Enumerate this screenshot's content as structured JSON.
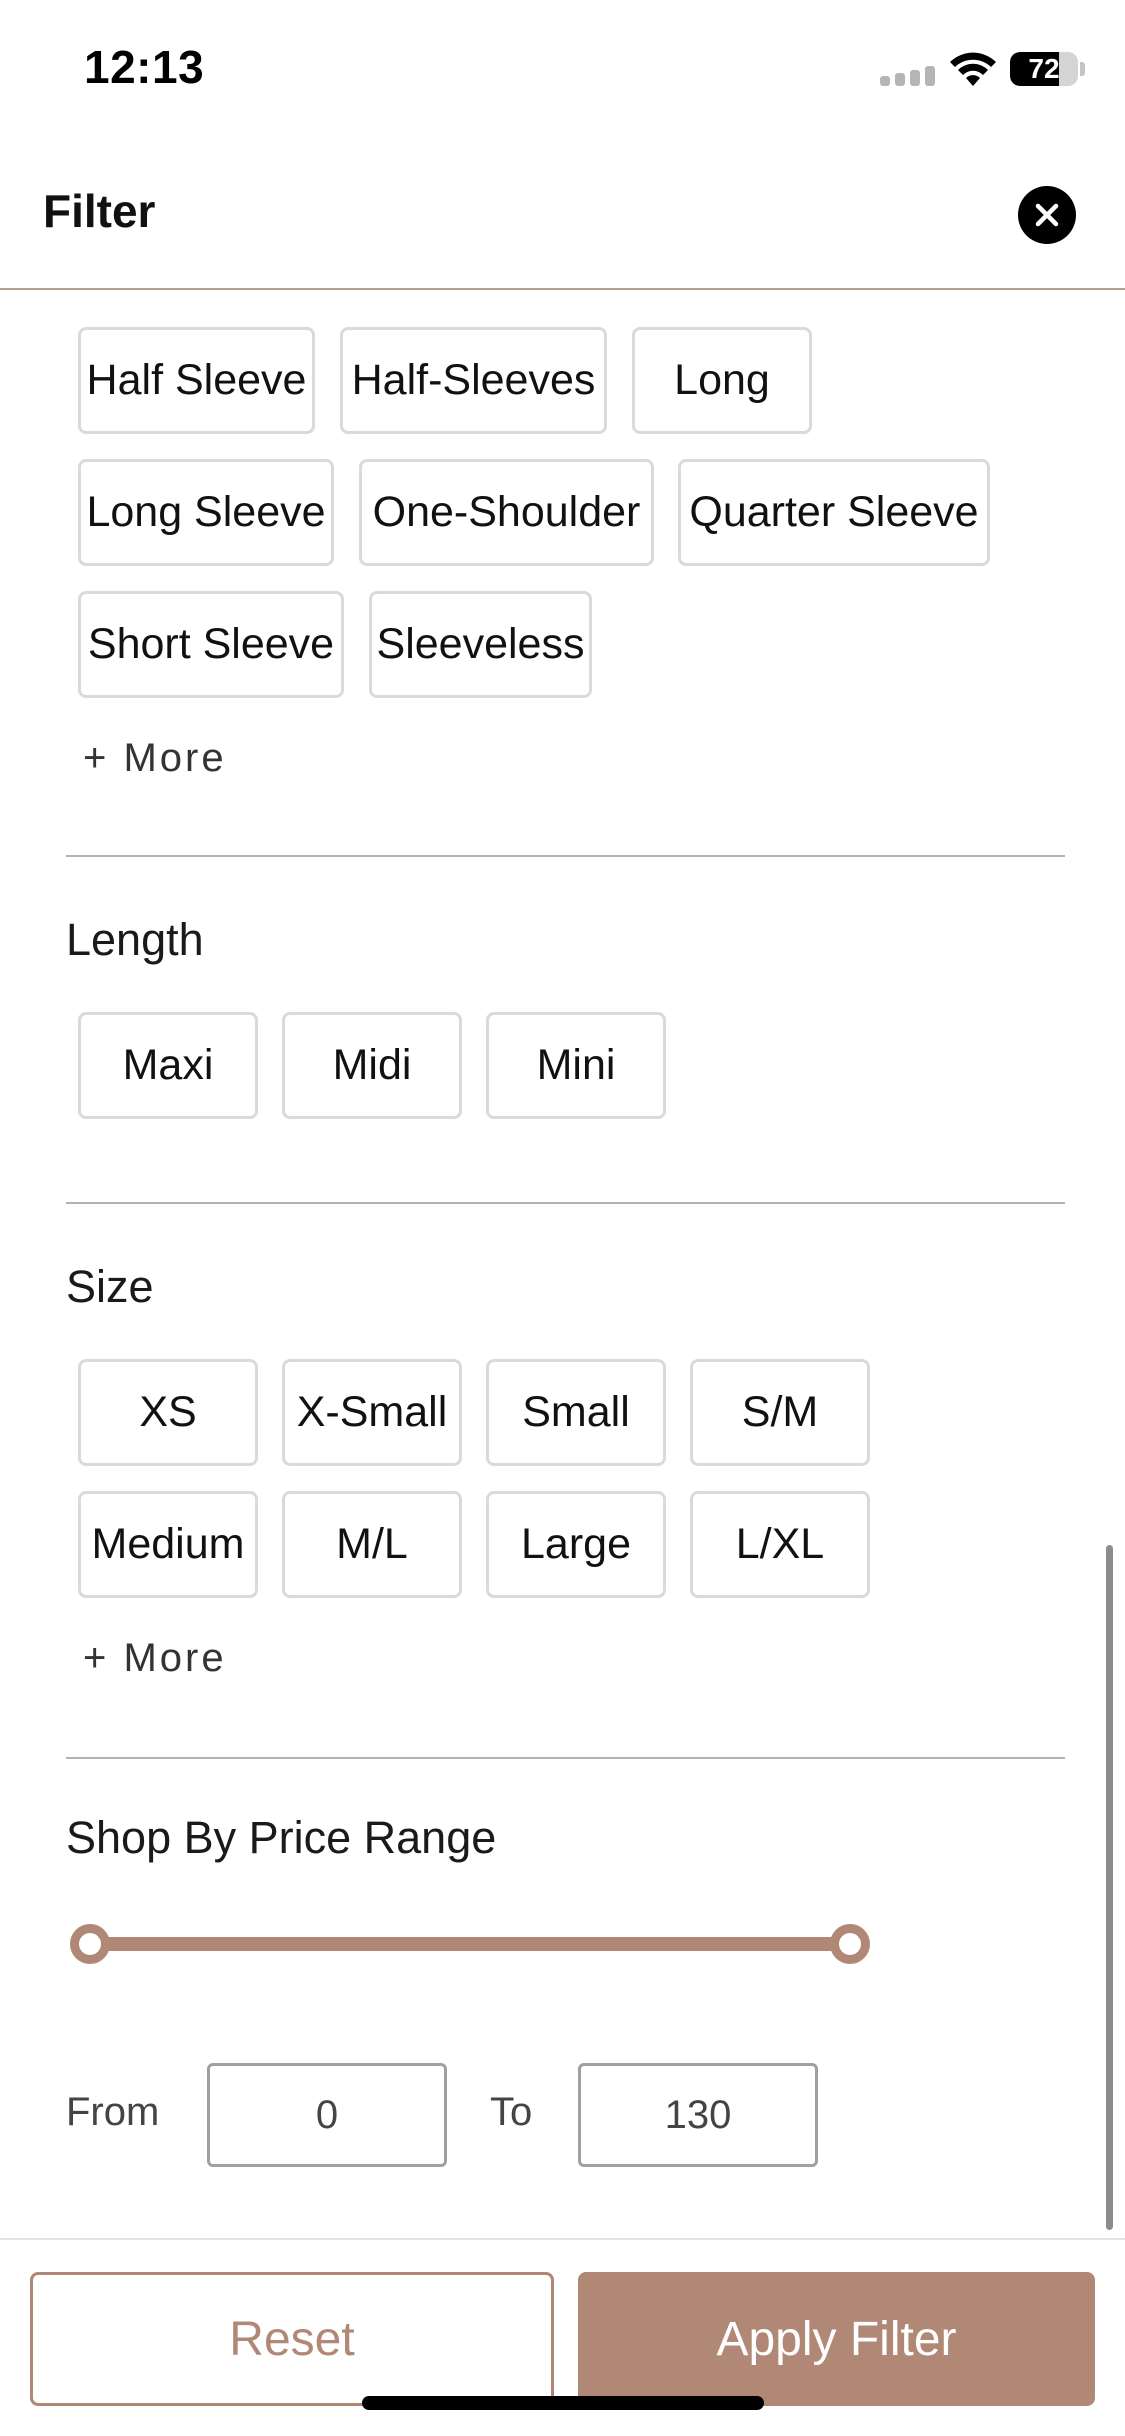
{
  "status_bar": {
    "time": "12:13",
    "battery": "72",
    "battery_level": 0.72
  },
  "header": {
    "title": "Filter"
  },
  "sleeve": {
    "options": [
      "Half Sleeve",
      "Half-Sleeves",
      "Long",
      "Long Sleeve",
      "One-Shoulder",
      "Quarter Sleeve",
      "Short Sleeve",
      "Sleeveless"
    ],
    "more_label": "+ More"
  },
  "length": {
    "title": "Length",
    "options": [
      "Maxi",
      "Midi",
      "Mini"
    ]
  },
  "size": {
    "title": "Size",
    "options": [
      "XS",
      "X-Small",
      "Small",
      "S/M",
      "Medium",
      "M/L",
      "Large",
      "L/XL"
    ],
    "more_label": "+ More"
  },
  "price": {
    "title": "Shop By Price Range",
    "from_label": "From",
    "from_value": "0",
    "to_label": "To",
    "to_value": "130",
    "range_min_fraction": 0,
    "range_max_fraction": 1
  },
  "actions": {
    "reset_label": "Reset",
    "apply_label": "Apply Filter"
  },
  "colors": {
    "accent": "#b08875",
    "divider": "#b3b3b3",
    "chip_border": "#dadada"
  },
  "icons": {
    "close": "close-icon",
    "wifi": "wifi-icon",
    "signal": "signal-icon",
    "battery": "battery-icon"
  }
}
